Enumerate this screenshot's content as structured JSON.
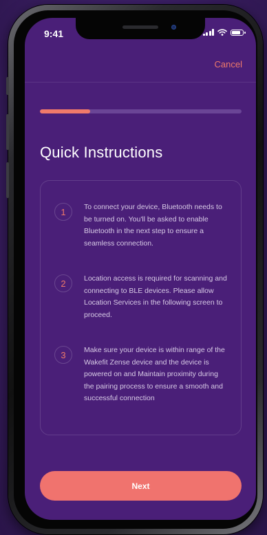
{
  "status_bar": {
    "time": "9:41"
  },
  "header": {
    "cancel_label": "Cancel"
  },
  "progress": {
    "value": 0.25
  },
  "main": {
    "title": "Quick Instructions",
    "steps": [
      {
        "number": "1",
        "text": "To connect your device, Bluetooth needs to be turned on. You'll be asked to enable Bluetooth in the next step to ensure a seamless connection."
      },
      {
        "number": "2",
        "text": "Location access is required for scanning and connecting to BLE devices. Please allow Location Services in the following screen to proceed."
      },
      {
        "number": "3",
        "text": "Make sure your device is within range of the Wakefit Zense device and the device is powered on and Maintain proximity during the pairing process to ensure a smooth and successful connection"
      }
    ]
  },
  "footer": {
    "next_label": "Next"
  },
  "colors": {
    "accent": "#f07a6a",
    "background": "#4a1f78",
    "button": "#f0736e"
  }
}
